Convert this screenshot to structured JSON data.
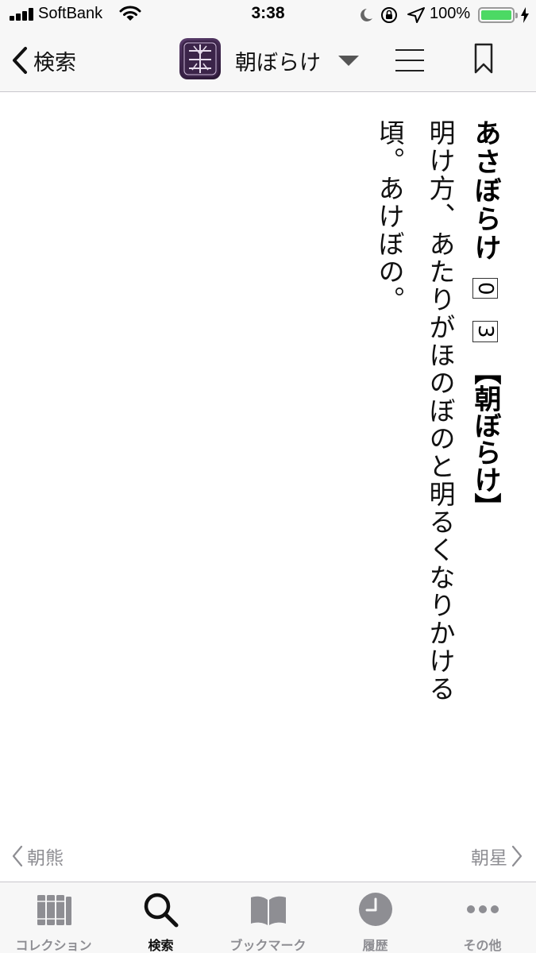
{
  "status_bar": {
    "carrier": "SoftBank",
    "time": "3:38",
    "battery_percent": "100%"
  },
  "nav": {
    "back_label": "検索",
    "app_icon": "dictionary-app-icon",
    "title": "朝ぼらけ"
  },
  "entry": {
    "reading": "あさぼらけ",
    "accent_marks": [
      "0",
      "3"
    ],
    "kanji_form": "【朝ぼらけ】",
    "definition_lines": [
      "明け方、あたりがほのぼのと明るくなりかける",
      "頃。あけぼの。"
    ]
  },
  "navigation": {
    "prev_label": "朝熊",
    "next_label": "朝星"
  },
  "tab_bar": {
    "tabs": [
      {
        "label": "コレクション",
        "icon": "books-icon"
      },
      {
        "label": "検索",
        "icon": "search-icon"
      },
      {
        "label": "ブックマーク",
        "icon": "open-book-icon"
      },
      {
        "label": "履歴",
        "icon": "clock-icon"
      },
      {
        "label": "その他",
        "icon": "more-dots-icon"
      }
    ],
    "active_index": 1
  },
  "colors": {
    "battery": "#4cd964",
    "tint": "#111111",
    "inactive": "#8e8e93",
    "app_icon": "#3b2449"
  }
}
